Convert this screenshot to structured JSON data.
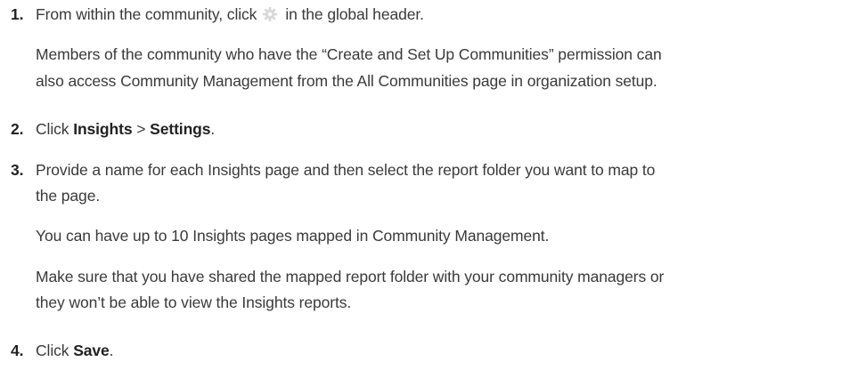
{
  "steps": [
    {
      "number": "1.",
      "text_before_icon": "From within the community, click",
      "icon": "gear-icon",
      "text_after_icon": "in the global header.",
      "note_line1": "Members of the community who have the “Create and Set Up Communities” permission can",
      "note_line2": "also access Community Management from the All Communities page in organization setup."
    },
    {
      "number": "2.",
      "prefix": "Click ",
      "bold1": "Insights",
      "separator": " > ",
      "bold2": "Settings",
      "suffix": "."
    },
    {
      "number": "3.",
      "line1": "Provide a name for each Insights page and then select the report folder you want to map to",
      "line2": "the page.",
      "para1": "You can have up to 10 Insights pages mapped in Community Management.",
      "para2_line1": "Make sure that you have shared the mapped report folder with your community managers or",
      "para2_line2": "they won’t be able to view the Insights reports."
    },
    {
      "number": "4.",
      "prefix": "Click ",
      "bold": "Save",
      "suffix": "."
    }
  ],
  "colors": {
    "text": "#3a3a3a",
    "gear_icon": "#d9d9d9"
  }
}
